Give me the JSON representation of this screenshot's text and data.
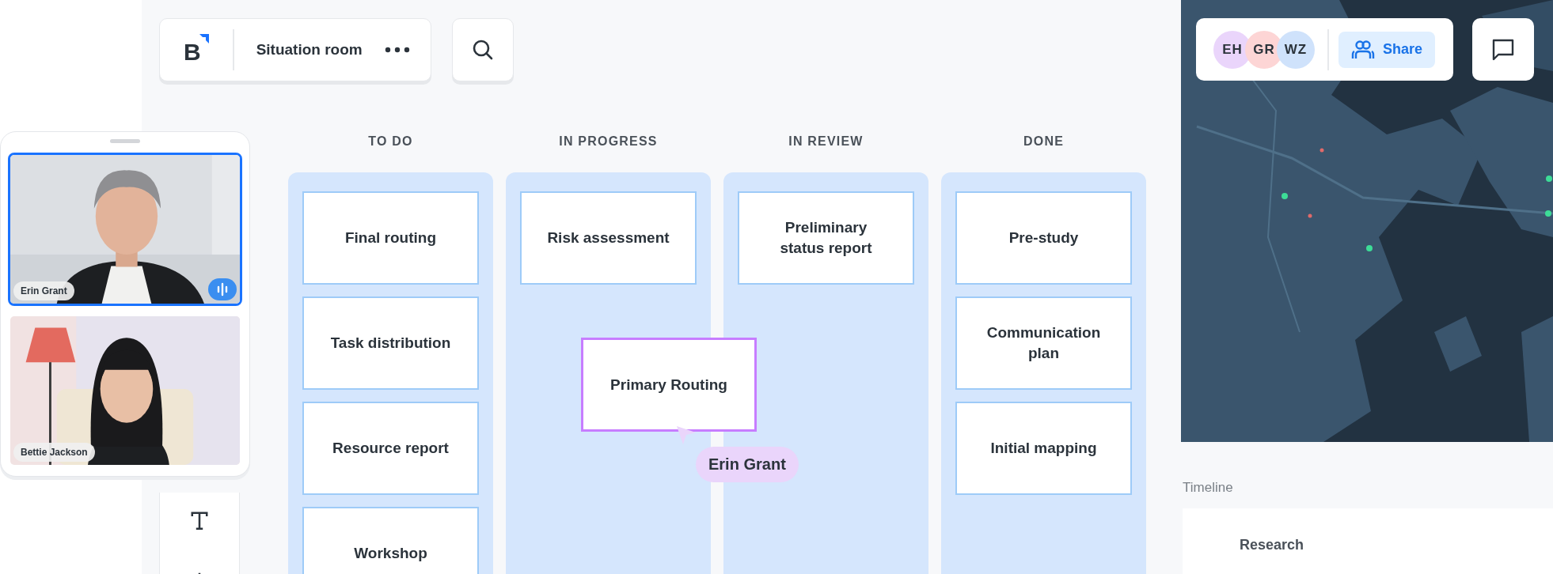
{
  "header": {
    "logo": "B",
    "title": "Situation room"
  },
  "participants": [
    {
      "name": "Erin Grant",
      "speaking": true
    },
    {
      "name": "Bettie Jackson",
      "speaking": false
    }
  ],
  "board": {
    "columns": [
      {
        "title": "TO DO",
        "cards": [
          "Final routing",
          "Task distribution",
          "Resource report",
          "Workshop"
        ]
      },
      {
        "title": "IN PROGRESS",
        "cards": [
          "Risk assessment"
        ]
      },
      {
        "title": "IN REVIEW",
        "cards": [
          "Preliminary status report"
        ]
      },
      {
        "title": "DONE",
        "cards": [
          "Pre-study",
          "Communication plan",
          "Initial mapping"
        ]
      }
    ]
  },
  "dragged_card": {
    "title": "Primary Routing",
    "user": "Erin Grant"
  },
  "collaborators": [
    {
      "initials": "EH",
      "color": "#ead5fb"
    },
    {
      "initials": "GR",
      "color": "#fdd5d5"
    },
    {
      "initials": "WZ",
      "color": "#cfe2fb"
    }
  ],
  "share_label": "Share",
  "timeline": {
    "title": "Timeline",
    "items": [
      "Research"
    ]
  }
}
